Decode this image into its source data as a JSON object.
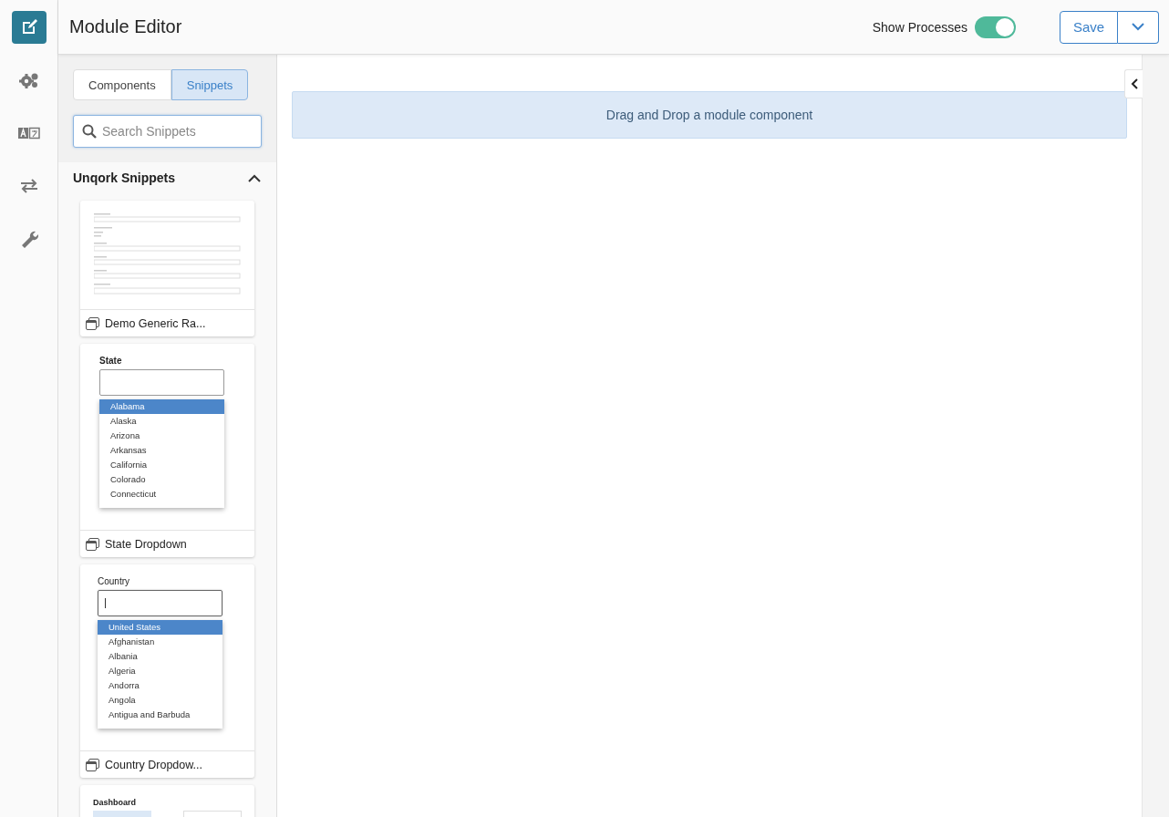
{
  "rail": [
    {
      "kind": "edit",
      "selected": true
    },
    {
      "kind": "gears",
      "selected": false
    },
    {
      "kind": "translate",
      "selected": false
    },
    {
      "kind": "swap",
      "selected": false
    },
    {
      "kind": "wrench",
      "selected": false
    }
  ],
  "header": {
    "title": "Module Editor",
    "show_processes": {
      "label": "Show Processes",
      "on": true
    },
    "save_button": "Save"
  },
  "panel": {
    "tabs": [
      {
        "label": "Components",
        "selected": false
      },
      {
        "label": "Snippets",
        "selected": true
      }
    ],
    "search": {
      "placeholder": "Search Snippets"
    },
    "section": {
      "title": "Unqork Snippets",
      "expanded": true
    },
    "snippets": [
      {
        "kind": "form",
        "name": "Demo Generic Ra..."
      },
      {
        "kind": "dropdown",
        "name": "State Dropdown",
        "preview": {
          "label": "State",
          "focused": false,
          "options": [
            {
              "label": "Alabama",
              "selected": true
            },
            {
              "label": "Alaska",
              "selected": false
            },
            {
              "label": "Arizona",
              "selected": false
            },
            {
              "label": "Arkansas",
              "selected": false
            },
            {
              "label": "California",
              "selected": false
            },
            {
              "label": "Colorado",
              "selected": false
            },
            {
              "label": "Connecticut",
              "selected": false
            }
          ]
        }
      },
      {
        "kind": "dropdown",
        "name": "Country Dropdow...",
        "preview": {
          "label": "Country",
          "focused": true,
          "options": [
            {
              "label": "United States",
              "selected": true
            },
            {
              "label": "Afghanistan",
              "selected": false
            },
            {
              "label": "Albania",
              "selected": false
            },
            {
              "label": "Algeria",
              "selected": false
            },
            {
              "label": "Andorra",
              "selected": false
            },
            {
              "label": "Angola",
              "selected": false
            },
            {
              "label": "Antigua and Barbuda",
              "selected": false
            }
          ]
        }
      },
      {
        "kind": "dashboard",
        "preview": {
          "label": "Dashboard"
        }
      }
    ]
  },
  "canvas": {
    "drop_hint": "Drag and Drop a module component"
  }
}
